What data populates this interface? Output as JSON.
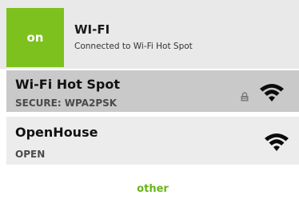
{
  "header": {
    "toggle_label": "on",
    "title": "WI-FI",
    "status": "Connected to Wi-Fi Hot Spot"
  },
  "networks": [
    {
      "name": "Wi-Fi Hot Spot",
      "security": "SECURE: WPA2PSK",
      "locked": true,
      "icon": "wifi-icon"
    },
    {
      "name": "OpenHouse",
      "security": "OPEN",
      "locked": false,
      "icon": "wifi-icon"
    }
  ],
  "other_label": "other",
  "colors": {
    "accent": "#7cc11d",
    "other_text": "#6ab41a",
    "header_bg": "#e9e9e9",
    "selected_row_bg": "#c9c9c9",
    "row_bg": "#ececec",
    "wifi_icon": "#0b0b0b"
  }
}
